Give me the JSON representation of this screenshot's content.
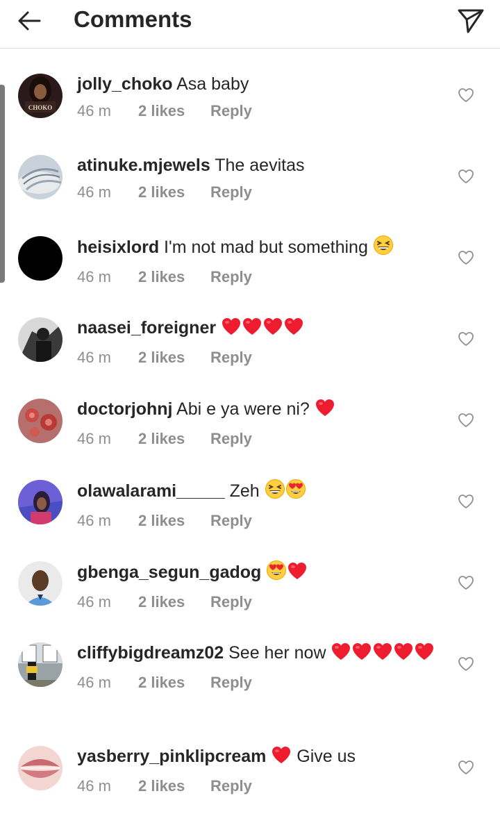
{
  "header": {
    "title": "Comments"
  },
  "comments": [
    {
      "username": "jolly_choko",
      "text": " Asa baby",
      "emojis": [],
      "time": "46 m",
      "likes": "2 likes",
      "reply": "Reply",
      "avatar_label": "CHOKO"
    },
    {
      "username": "atinuke.mjewels",
      "text": " The aevitas",
      "emojis": [],
      "time": "46 m",
      "likes": "2 likes",
      "reply": "Reply"
    },
    {
      "username": "heisixlord",
      "text": " I'm not mad but something ",
      "emojis": [
        "grin"
      ],
      "time": "46 m",
      "likes": "2 likes",
      "reply": "Reply"
    },
    {
      "username": "naasei_foreigner",
      "text": " ",
      "emojis": [
        "heart",
        "heart",
        "heart",
        "heart"
      ],
      "time": "46 m",
      "likes": "2 likes",
      "reply": "Reply"
    },
    {
      "username": "doctorjohnj",
      "text": " Abi e ya were ni? ",
      "emojis": [
        "heart"
      ],
      "time": "46 m",
      "likes": "2 likes",
      "reply": "Reply"
    },
    {
      "username": "olawalarami_____",
      "text": " Zeh ",
      "emojis": [
        "grin",
        "heart-eyes"
      ],
      "time": "46 m",
      "likes": "2 likes",
      "reply": "Reply"
    },
    {
      "username": "gbenga_segun_gadog",
      "text": " ",
      "emojis": [
        "heart-eyes",
        "heart"
      ],
      "time": "46 m",
      "likes": "2 likes",
      "reply": "Reply"
    },
    {
      "username": "cliffybigdreamz02",
      "text": " See her now ",
      "emojis": [
        "heart",
        "heart",
        "heart",
        "heart",
        "heart"
      ],
      "time": "46 m",
      "likes": "2 likes",
      "reply": "Reply"
    },
    {
      "username": "yasberry_pinklipcream",
      "text": " ",
      "emojis": [
        "heart"
      ],
      "text_after": " Give us",
      "time": "46 m",
      "likes": "2 likes",
      "reply": "Reply"
    }
  ],
  "colors": {
    "text": "#262626",
    "meta": "#8e8e8e",
    "heart": "#ed1c2e",
    "divider": "#dbdbdb"
  },
  "icons": {
    "back": "arrow-left-icon",
    "share": "paper-plane-icon",
    "like": "heart-outline-icon"
  }
}
